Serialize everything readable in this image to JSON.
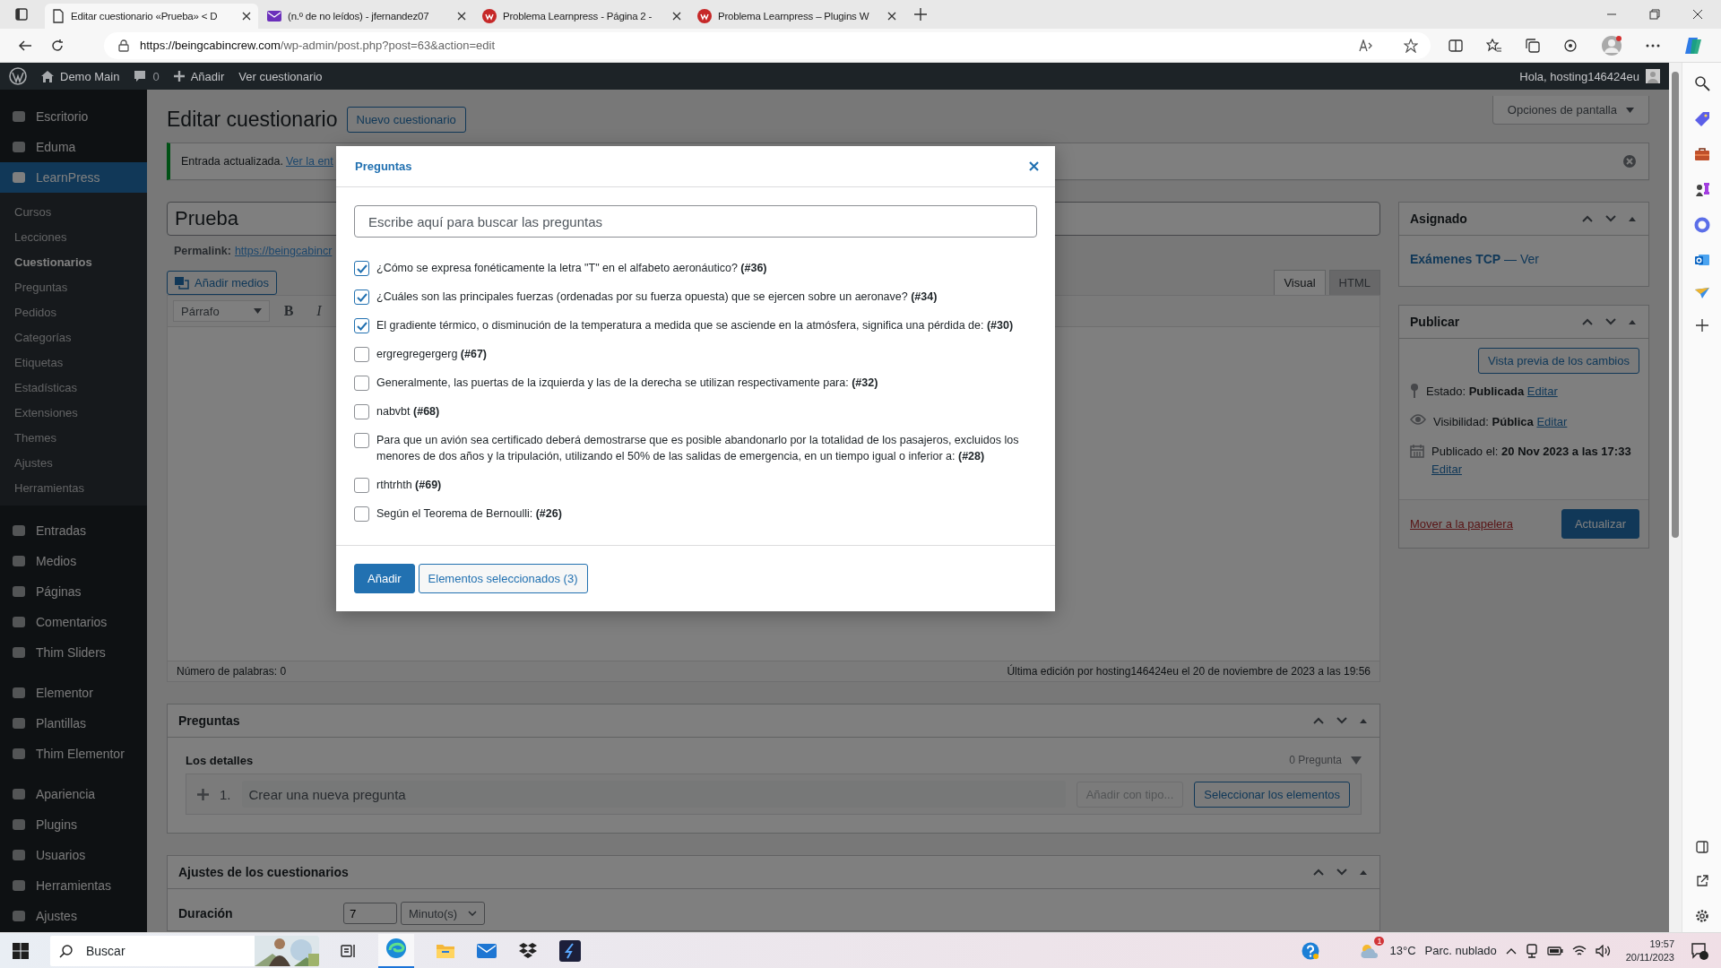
{
  "browser": {
    "tabs": [
      {
        "title": "Editar cuestionario «Prueba» < D",
        "selected": true
      },
      {
        "title": "(n.º de no leídos) - jfernandez07",
        "selected": false
      },
      {
        "title": "Problema Learnpress - Página 2 -",
        "selected": false
      },
      {
        "title": "Problema Learnpress – Plugins W",
        "selected": false
      }
    ],
    "url_host": "https://beingcabincrew.com",
    "url_path": "/wp-admin/post.php?post=63&action=edit"
  },
  "admin_bar": {
    "site": "Demo Main",
    "comments": "0",
    "new": "Añadir",
    "view": "Ver cuestionario",
    "greeting": "Hola, hosting146424eu"
  },
  "sidebar": {
    "groups": [
      [
        {
          "label": "Escritorio",
          "selected": false
        },
        {
          "label": "Eduma",
          "selected": false
        },
        {
          "label": "LearnPress",
          "selected": true,
          "children": [
            {
              "label": "Cursos",
              "selected": false
            },
            {
              "label": "Lecciones",
              "selected": false
            },
            {
              "label": "Cuestionarios",
              "selected": true
            },
            {
              "label": "Preguntas",
              "selected": false
            },
            {
              "label": "Pedidos",
              "selected": false
            },
            {
              "label": "Categorías",
              "selected": false
            },
            {
              "label": "Etiquetas",
              "selected": false
            },
            {
              "label": "Estadísticas",
              "selected": false
            },
            {
              "label": "Extensiones",
              "selected": false
            },
            {
              "label": "Themes",
              "selected": false
            },
            {
              "label": "Ajustes",
              "selected": false
            },
            {
              "label": "Herramientas",
              "selected": false
            }
          ]
        }
      ],
      [
        {
          "label": "Entradas",
          "selected": false
        },
        {
          "label": "Medios",
          "selected": false
        },
        {
          "label": "Páginas",
          "selected": false
        },
        {
          "label": "Comentarios",
          "selected": false
        },
        {
          "label": "Thim Sliders",
          "selected": false
        }
      ],
      [
        {
          "label": "Elementor",
          "selected": false
        },
        {
          "label": "Plantillas",
          "selected": false
        },
        {
          "label": "Thim Elementor",
          "selected": false
        }
      ],
      [
        {
          "label": "Apariencia",
          "selected": false
        },
        {
          "label": "Plugins",
          "selected": false
        },
        {
          "label": "Usuarios",
          "selected": false
        },
        {
          "label": "Herramientas",
          "selected": false
        },
        {
          "label": "Ajustes",
          "selected": false
        }
      ]
    ]
  },
  "page": {
    "title": "Editar cuestionario",
    "new_button": "Nuevo cuestionario",
    "screen_options": "Opciones de pantalla",
    "notice": {
      "text": "Entrada actualizada.",
      "link": "Ver la ent"
    },
    "post_title": "Prueba",
    "permalink_label": "Permalink:",
    "permalink": "https://beingcabincr",
    "add_media": "Añadir medios",
    "editor_tabs": [
      {
        "label": "Visual",
        "selected": true
      },
      {
        "label": "HTML",
        "selected": false
      }
    ],
    "format": "Párrafo",
    "bold": "B",
    "italic": "I",
    "word_count": "Número de palabras: 0",
    "last_edit": "Última edición por hosting146424eu el 20 de noviembre de 2023 a las 19:56",
    "questions_box": {
      "title": "Preguntas",
      "details": "Los detalles",
      "count": "0 Pregunta",
      "row_number": "1.",
      "new_placeholder": "Crear una nueva pregunta",
      "add_typed": "Añadir con tipo...",
      "select_items": "Seleccionar los elementos"
    },
    "settings_box": {
      "title": "Ajustes de los cuestionarios",
      "duration_label": "Duración",
      "duration_value": "7",
      "duration_unit": "Minuto(s)"
    },
    "assigned": {
      "title": "Asignado",
      "course": "Exámenes TCP",
      "separator": " — ",
      "view": "Ver"
    },
    "publish": {
      "title": "Publicar",
      "preview": "Vista previa de los cambios",
      "rows": [
        {
          "kind": "status",
          "label": "Estado:",
          "value": "Publicada",
          "edit": "Editar"
        },
        {
          "kind": "visibility",
          "label": "Visibilidad:",
          "value": "Pública",
          "edit": "Editar"
        },
        {
          "kind": "date",
          "label": "Publicado el:",
          "value": "20 Nov 2023 a las 17:33",
          "edit": "Editar"
        }
      ],
      "trash": "Mover a la papelera",
      "update": "Actualizar"
    }
  },
  "modal": {
    "title": "Preguntas",
    "search_placeholder": "Escribe aquí para buscar las preguntas",
    "items": [
      {
        "text": "¿Cómo se expresa fonéticamente la letra \"T\" en el alfabeto aeronáutico?",
        "ref": "(#36)",
        "checked": true
      },
      {
        "text": "¿Cuáles son las principales fuerzas (ordenadas por su fuerza opuesta) que se ejercen sobre un aeronave?",
        "ref": "(#34)",
        "checked": true
      },
      {
        "text": "El gradiente térmico, o disminución de la temperatura a medida que se asciende en la atmósfera, significa una pérdida de:",
        "ref": "(#30)",
        "checked": true
      },
      {
        "text": "ergregregergerg",
        "ref": "(#67)",
        "checked": false
      },
      {
        "text": "Generalmente, las puertas de la izquierda y las de la derecha se utilizan respectivamente para:",
        "ref": "(#32)",
        "checked": false
      },
      {
        "text": "nabvbt",
        "ref": "(#68)",
        "checked": false
      },
      {
        "text": "Para que un avión sea certificado deberá demostrarse que es posible abandonarlo por la totalidad de los pasajeros, excluidos los menores de dos años y la tripulación, utilizando el 50% de las salidas de emergencia, en un tiempo igual o inferior a:",
        "ref": "(#28)",
        "checked": false
      },
      {
        "text": "rthtrhth",
        "ref": "(#69)",
        "checked": false
      },
      {
        "text": "Según el Teorema de Bernoulli:",
        "ref": "(#26)",
        "checked": false
      }
    ],
    "add_button": "Añadir",
    "selected_button": "Elementos seleccionados (3)"
  },
  "taskbar": {
    "search": "Buscar",
    "weather_badge": "1",
    "temperature": "13°C",
    "weather": "Parc. nublado",
    "time": "19:57",
    "date": "20/11/2023"
  }
}
